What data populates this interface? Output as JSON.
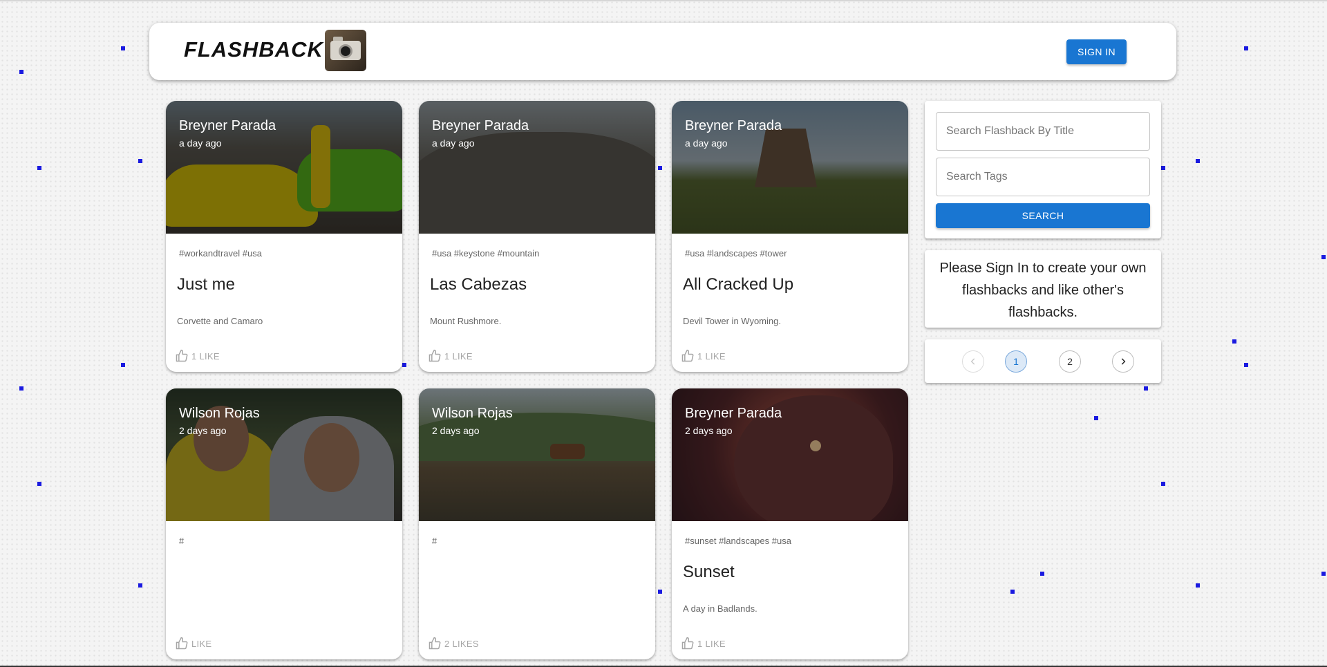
{
  "header": {
    "brand": "FLASHBACK",
    "signin_label": "SIGN IN"
  },
  "posts": [
    {
      "author": "Breyner Parada",
      "time": "a day ago",
      "tags": "#workandtravel #usa",
      "title": "Just me",
      "message": "Corvette and Camaro",
      "likes": "1 LIKE"
    },
    {
      "author": "Breyner Parada",
      "time": "a day ago",
      "tags": "#usa #keystone #mountain",
      "title": "Las Cabezas",
      "message": "Mount Rushmore.",
      "likes": "1 LIKE"
    },
    {
      "author": "Breyner Parada",
      "time": "a day ago",
      "tags": "#usa #landscapes #tower",
      "title": "All Cracked Up",
      "message": "Devil Tower in Wyoming.",
      "likes": "1 LIKE"
    },
    {
      "author": "Wilson Rojas",
      "time": "2 days ago",
      "tags": "#",
      "title": "",
      "message": "",
      "likes": "LIKE"
    },
    {
      "author": "Wilson Rojas",
      "time": "2 days ago",
      "tags": "#",
      "title": "",
      "message": "",
      "likes": "2 LIKES"
    },
    {
      "author": "Breyner Parada",
      "time": "2 days ago",
      "tags": "#sunset #landscapes #usa",
      "title": "Sunset",
      "message": "A day in Badlands.",
      "likes": "1 LIKE"
    }
  ],
  "search": {
    "title_placeholder": "Search Flashback By Title",
    "tags_placeholder": "Search Tags",
    "button_label": "SEARCH"
  },
  "notice": "Please Sign In to create your own flashbacks and like other's flashbacks.",
  "pagination": {
    "pages": [
      "1",
      "2"
    ],
    "current_page": "1",
    "prev_icon": "chevron-left-icon",
    "next_icon": "chevron-right-icon"
  },
  "colors": {
    "primary": "#1976d2",
    "background_dots": "#1a1ae0"
  }
}
